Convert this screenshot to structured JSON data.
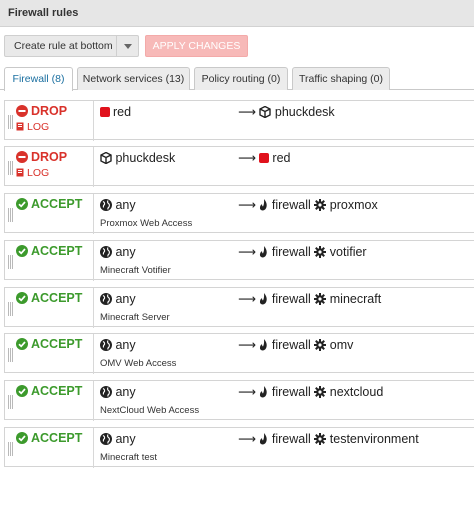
{
  "header": {
    "title": "Firewall rules"
  },
  "toolbar": {
    "create_label": "Create rule at bottom",
    "apply_label": "APPLY CHANGES"
  },
  "tabs": [
    {
      "label": "Firewall (8)",
      "active": true
    },
    {
      "label": "Network services (13)",
      "active": false
    },
    {
      "label": "Policy routing (0)",
      "active": false
    },
    {
      "label": "Traffic shaping (0)",
      "active": false
    }
  ],
  "rules": [
    {
      "action": "DROP",
      "log": "LOG",
      "source": "red",
      "source_icon": "red-zone-square",
      "arrow": "⟶",
      "dest": "phuckdesk",
      "dest_icon": "cube-icon",
      "service": "",
      "description": ""
    },
    {
      "action": "DROP",
      "log": "LOG",
      "source": "phuckdesk",
      "source_icon": "cube-icon",
      "arrow": "⟶",
      "dest": "red",
      "dest_icon": "red-zone-square",
      "service": "",
      "description": ""
    },
    {
      "action": "ACCEPT",
      "source": "any",
      "source_icon": "globe-icon",
      "arrow": "⟶",
      "dest": "firewall",
      "dest_icon": "flame-icon",
      "service": "proxmox",
      "service_icon": "gear-icon",
      "description": "Proxmox Web Access"
    },
    {
      "action": "ACCEPT",
      "source": "any",
      "source_icon": "globe-icon",
      "arrow": "⟶",
      "dest": "firewall",
      "dest_icon": "flame-icon",
      "service": "votifier",
      "service_icon": "gear-icon",
      "description": "Minecraft Votifier"
    },
    {
      "action": "ACCEPT",
      "source": "any",
      "source_icon": "globe-icon",
      "arrow": "⟶",
      "dest": "firewall",
      "dest_icon": "flame-icon",
      "service": "minecraft",
      "service_icon": "gear-icon",
      "description": "Minecraft Server"
    },
    {
      "action": "ACCEPT",
      "source": "any",
      "source_icon": "globe-icon",
      "arrow": "⟶",
      "dest": "firewall",
      "dest_icon": "flame-icon",
      "service": "omv",
      "service_icon": "gear-icon",
      "description": "OMV Web Access"
    },
    {
      "action": "ACCEPT",
      "source": "any",
      "source_icon": "globe-icon",
      "arrow": "⟶",
      "dest": "firewall",
      "dest_icon": "flame-icon",
      "service": "nextcloud",
      "service_icon": "gear-icon",
      "description": "NextCloud Web Access"
    },
    {
      "action": "ACCEPT",
      "source": "any",
      "source_icon": "globe-icon",
      "arrow": "⟶",
      "dest": "firewall",
      "dest_icon": "flame-icon",
      "service": "testenvironment",
      "service_icon": "gear-icon",
      "description": "Minecraft test"
    }
  ],
  "colors": {
    "drop": "#d9322b",
    "accept": "#3c9a2c",
    "red_zone": "#e0121c",
    "apply_button": "#f7b9b8",
    "active_tab_text": "#1a6fa0"
  }
}
